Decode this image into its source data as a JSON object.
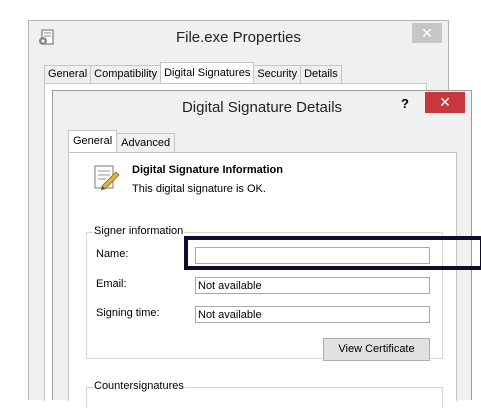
{
  "outer_window": {
    "title": "File.exe Properties",
    "close_glyph": "✕",
    "tabs": [
      {
        "label": "General",
        "active": false
      },
      {
        "label": "Compatibility",
        "active": false
      },
      {
        "label": "Digital Signatures",
        "active": true
      },
      {
        "label": "Security",
        "active": false
      },
      {
        "label": "Details",
        "active": false
      }
    ]
  },
  "dialog": {
    "title": "Digital Signature Details",
    "help_glyph": "?",
    "close_glyph": "✕",
    "tabs": [
      {
        "label": "General",
        "active": true
      },
      {
        "label": "Advanced",
        "active": false
      }
    ],
    "info": {
      "heading": "Digital Signature Information",
      "status": "This digital signature is OK."
    },
    "signer": {
      "legend": "Signer information",
      "name_label": "Name:",
      "name_value": "",
      "email_label": "Email:",
      "email_value": "Not available",
      "signing_time_label": "Signing time:",
      "signing_time_value": "Not available",
      "view_certificate_label": "View Certificate"
    },
    "countersignatures": {
      "legend": "Countersignatures"
    }
  },
  "colors": {
    "dialog_close": "#c7383d",
    "highlight_border": "#130b2e"
  },
  "icons": {
    "outer_app": "file-properties-icon",
    "certificate": "certificate-icon"
  }
}
